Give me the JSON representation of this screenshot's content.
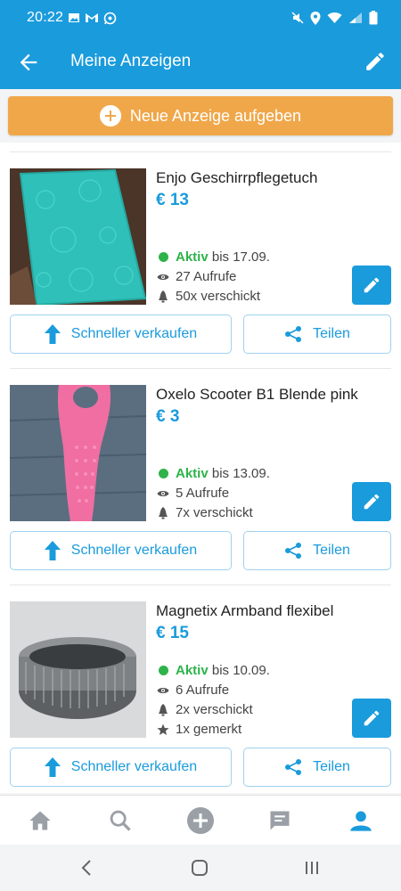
{
  "status_bar": {
    "time": "20:22",
    "left_icons": [
      "image-icon",
      "gmail-icon",
      "whatsapp-icon"
    ],
    "right_icons": [
      "mute-icon",
      "location-icon",
      "wifi-icon",
      "signal-icon",
      "battery-icon"
    ]
  },
  "appbar": {
    "title": "Meine Anzeigen",
    "back_icon": "arrow-left-icon",
    "edit_icon": "pencil-icon"
  },
  "banner": {
    "label": "Neue Anzeige aufgeben"
  },
  "colors": {
    "primary": "#1a9bdc",
    "accent_orange": "#f0a74a",
    "active_green": "#2eb34a"
  },
  "listings": [
    {
      "title": "Enjo Geschirrpflegetuch",
      "price": "€ 13",
      "status": "Aktiv",
      "until": "bis 17.09.",
      "views": "27 Aufrufe",
      "sent": "50x verschickt",
      "fast_label": "Schneller verkaufen",
      "share_label": "Teilen"
    },
    {
      "title": "Oxelo Scooter B1 Blende pink",
      "price": "€ 3",
      "status": "Aktiv",
      "until": "bis 13.09.",
      "views": "5 Aufrufe",
      "sent": "7x verschickt",
      "fast_label": "Schneller verkaufen",
      "share_label": "Teilen"
    },
    {
      "title": "Magnetix Armband flexibel",
      "price": "€ 15",
      "status": "Aktiv",
      "until": "bis 10.09.",
      "views": "6 Aufrufe",
      "sent": "2x verschickt",
      "saved": "1x gemerkt",
      "fast_label": "Schneller verkaufen",
      "share_label": "Teilen"
    }
  ],
  "bottom_nav": [
    "home-icon",
    "search-icon",
    "add-icon",
    "messages-icon",
    "profile-icon"
  ],
  "system_nav": [
    "back-icon",
    "home-icon",
    "recents-icon"
  ]
}
